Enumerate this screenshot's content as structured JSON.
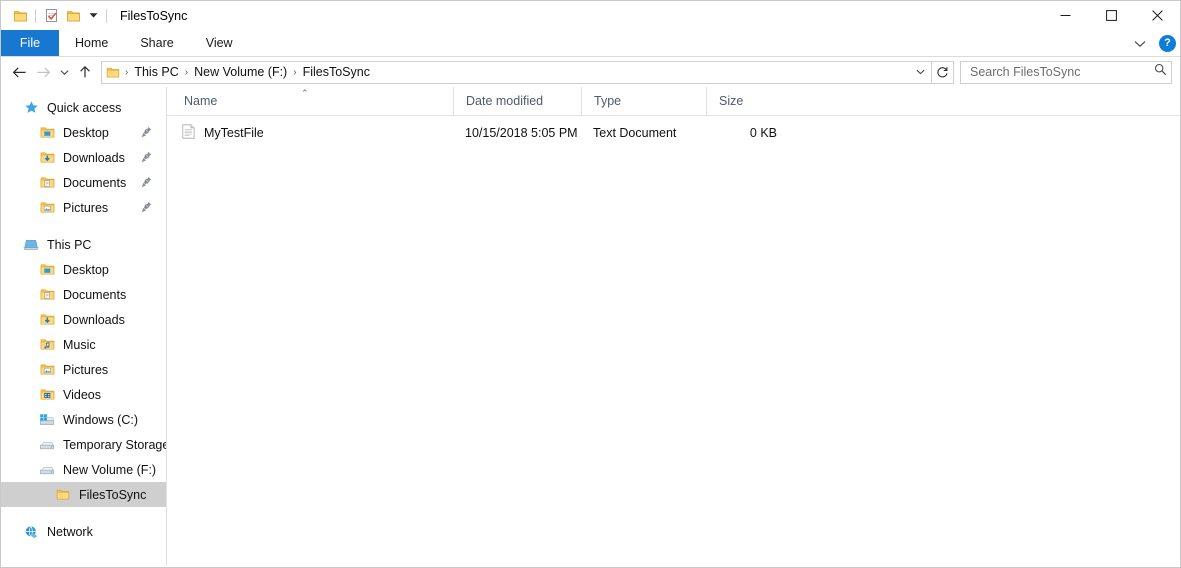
{
  "window": {
    "title": "FilesToSync",
    "quick_access_toolbar": [
      {
        "name": "folder-icon",
        "label": "Folder"
      },
      {
        "name": "properties-icon",
        "label": "Properties"
      },
      {
        "name": "new-folder-icon",
        "label": "New folder"
      },
      {
        "name": "chevron-down-icon",
        "label": "Customize Quick Access Toolbar"
      }
    ],
    "controls": {
      "minimize": "–",
      "maximize": "□",
      "close": "✕"
    }
  },
  "ribbon": {
    "tabs": [
      {
        "label": "File",
        "active": true
      },
      {
        "label": "Home",
        "active": false
      },
      {
        "label": "Share",
        "active": false
      },
      {
        "label": "View",
        "active": false
      }
    ],
    "minimize_icon": "chevron-down-icon",
    "help_label": "?"
  },
  "addressbar": {
    "back_label": "←",
    "forward_label": "→",
    "recent_label": "⌄",
    "up_label": "↑",
    "crumbs": [
      "This PC",
      "New Volume (F:)",
      "FilesToSync"
    ],
    "separator": "›",
    "dropdown_icon": "chevron-down-icon",
    "refresh_icon": "↻"
  },
  "search": {
    "placeholder": "Search FilesToSync",
    "value": "",
    "icon": "search-icon"
  },
  "sidebar": {
    "groups": [
      {
        "name": "quick-access",
        "items": [
          {
            "label": "Quick access",
            "icon": "star-icon",
            "level": 0,
            "pinned": false,
            "selected": false
          },
          {
            "label": "Desktop",
            "icon": "folder-desktop-icon",
            "level": 1,
            "pinned": true,
            "selected": false
          },
          {
            "label": "Downloads",
            "icon": "folder-downloads-icon",
            "level": 1,
            "pinned": true,
            "selected": false
          },
          {
            "label": "Documents",
            "icon": "folder-documents-icon",
            "level": 1,
            "pinned": true,
            "selected": false
          },
          {
            "label": "Pictures",
            "icon": "folder-pictures-icon",
            "level": 1,
            "pinned": true,
            "selected": false
          }
        ]
      },
      {
        "name": "this-pc",
        "items": [
          {
            "label": "This PC",
            "icon": "computer-icon",
            "level": 0,
            "pinned": false,
            "selected": false
          },
          {
            "label": "Desktop",
            "icon": "folder-desktop-icon",
            "level": 1,
            "pinned": false,
            "selected": false
          },
          {
            "label": "Documents",
            "icon": "folder-documents-icon",
            "level": 1,
            "pinned": false,
            "selected": false
          },
          {
            "label": "Downloads",
            "icon": "folder-downloads-icon",
            "level": 1,
            "pinned": false,
            "selected": false
          },
          {
            "label": "Music",
            "icon": "folder-music-icon",
            "level": 1,
            "pinned": false,
            "selected": false
          },
          {
            "label": "Pictures",
            "icon": "folder-pictures-icon",
            "level": 1,
            "pinned": false,
            "selected": false
          },
          {
            "label": "Videos",
            "icon": "folder-videos-icon",
            "level": 1,
            "pinned": false,
            "selected": false
          },
          {
            "label": "Windows (C:)",
            "icon": "windows-drive-icon",
            "level": 1,
            "pinned": false,
            "selected": false
          },
          {
            "label": "Temporary Storage (",
            "icon": "drive-icon",
            "level": 1,
            "pinned": false,
            "selected": false
          },
          {
            "label": "New Volume (F:)",
            "icon": "drive-icon",
            "level": 1,
            "pinned": false,
            "selected": false
          },
          {
            "label": "FilesToSync",
            "icon": "folder-icon",
            "level": 2,
            "pinned": false,
            "selected": true
          }
        ]
      },
      {
        "name": "network",
        "items": [
          {
            "label": "Network",
            "icon": "network-icon",
            "level": 0,
            "pinned": false,
            "selected": false
          }
        ]
      }
    ]
  },
  "filelist": {
    "columns": [
      {
        "label": "Name",
        "sorted": "asc"
      },
      {
        "label": "Date modified",
        "sorted": ""
      },
      {
        "label": "Type",
        "sorted": ""
      },
      {
        "label": "Size",
        "sorted": ""
      }
    ],
    "sort_caret": "⌃",
    "rows": [
      {
        "name": "MyTestFile",
        "date_modified": "10/15/2018 5:05 PM",
        "type": "Text Document",
        "size": "0 KB",
        "icon": "text-document-icon"
      }
    ]
  },
  "colors": {
    "accent": "#1878d0",
    "help_blue": "#0d7ddb",
    "folder_yellow": "#ffd179",
    "selection_gray": "#cfcfcf",
    "header_text": "#4d5b6b"
  }
}
